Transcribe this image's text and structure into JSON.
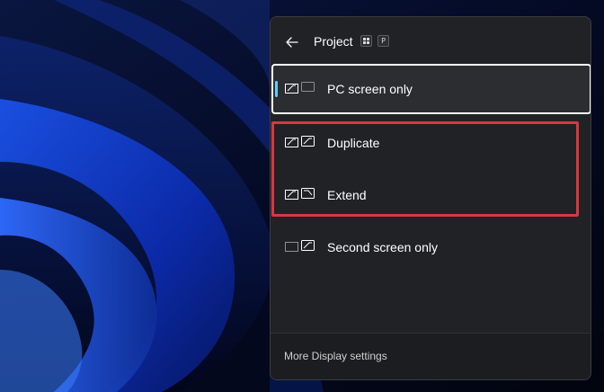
{
  "flyout": {
    "title": "Project",
    "shortcut_keys": [
      "P"
    ],
    "options": [
      {
        "label": "PC screen only",
        "icon": "pc-screen-only-icon",
        "selected": true
      },
      {
        "label": "Duplicate",
        "icon": "duplicate-icon",
        "selected": false
      },
      {
        "label": "Extend",
        "icon": "extend-icon",
        "selected": false
      },
      {
        "label": "Second screen only",
        "icon": "second-screen-only-icon",
        "selected": false
      }
    ],
    "footer_link": "More Display settings"
  },
  "colors": {
    "accent": "#60cdff",
    "highlight_annotation": "#d9373e",
    "panel_background": "#202225"
  }
}
